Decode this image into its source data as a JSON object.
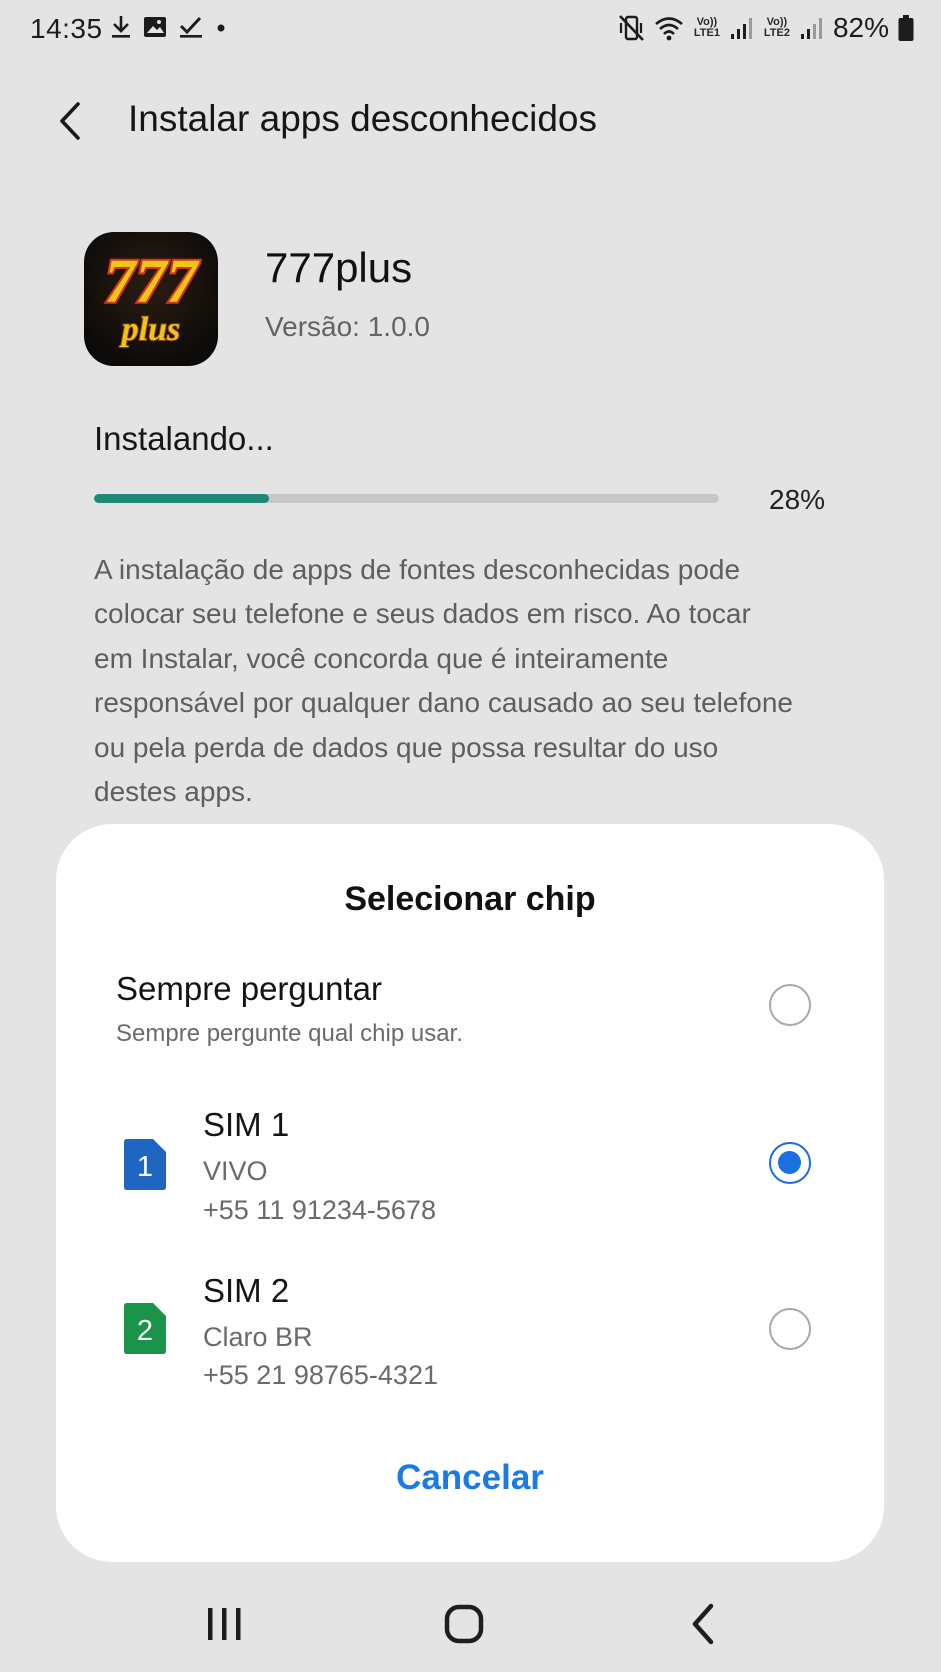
{
  "status_bar": {
    "time": "14:35",
    "battery_percent": "82%",
    "lte1": "LTE1",
    "lte2": "LTE2",
    "volte": "Vo))",
    "left_icons": [
      "download-icon",
      "image-icon",
      "check-icon",
      "dot-icon"
    ],
    "right_icons": [
      "mute-vibrate-icon",
      "wifi-icon",
      "signal-1-icon",
      "signal-2-icon",
      "battery-icon"
    ]
  },
  "header": {
    "back_icon": "chevron-left-icon",
    "title": "Instalar apps desconhecidos"
  },
  "app": {
    "name": "777plus",
    "version": "Versão: 1.0.0",
    "icon_text_top": "777",
    "icon_text_bottom": "plus"
  },
  "install": {
    "status": "Instalando...",
    "progress": 0.28,
    "progress_label": "28%",
    "progress_color": "#1d8a78",
    "warning": "A instalação de apps de fontes desconhecidas pode colocar seu telefone e seus dados em risco. Ao tocar em Instalar, você concorda que é inteiramente responsável por qualquer dano causado ao seu telefone ou pela perda de dados que possa resultar do uso destes apps."
  },
  "dialog": {
    "title": "Selecionar chip",
    "options": [
      {
        "title": "Sempre perguntar",
        "subtitle": "Sempre pergunte qual chip usar.",
        "selected": false
      },
      {
        "title": "SIM 1",
        "carrier": "VIVO",
        "number": "+55 11 91234-5678",
        "sim_badge": "1",
        "sim_color": "#1f66c2",
        "selected": true
      },
      {
        "title": "SIM 2",
        "carrier": "Claro BR",
        "number": "+55 21 98765-4321",
        "sim_badge": "2",
        "sim_color": "#1a9448",
        "selected": false
      }
    ],
    "cancel_label": "Cancelar",
    "accent_color": "#1b6fe0"
  },
  "nav_bar": {
    "recent_icon": "recent-apps-icon",
    "home_icon": "home-icon",
    "back_icon": "back-icon"
  }
}
